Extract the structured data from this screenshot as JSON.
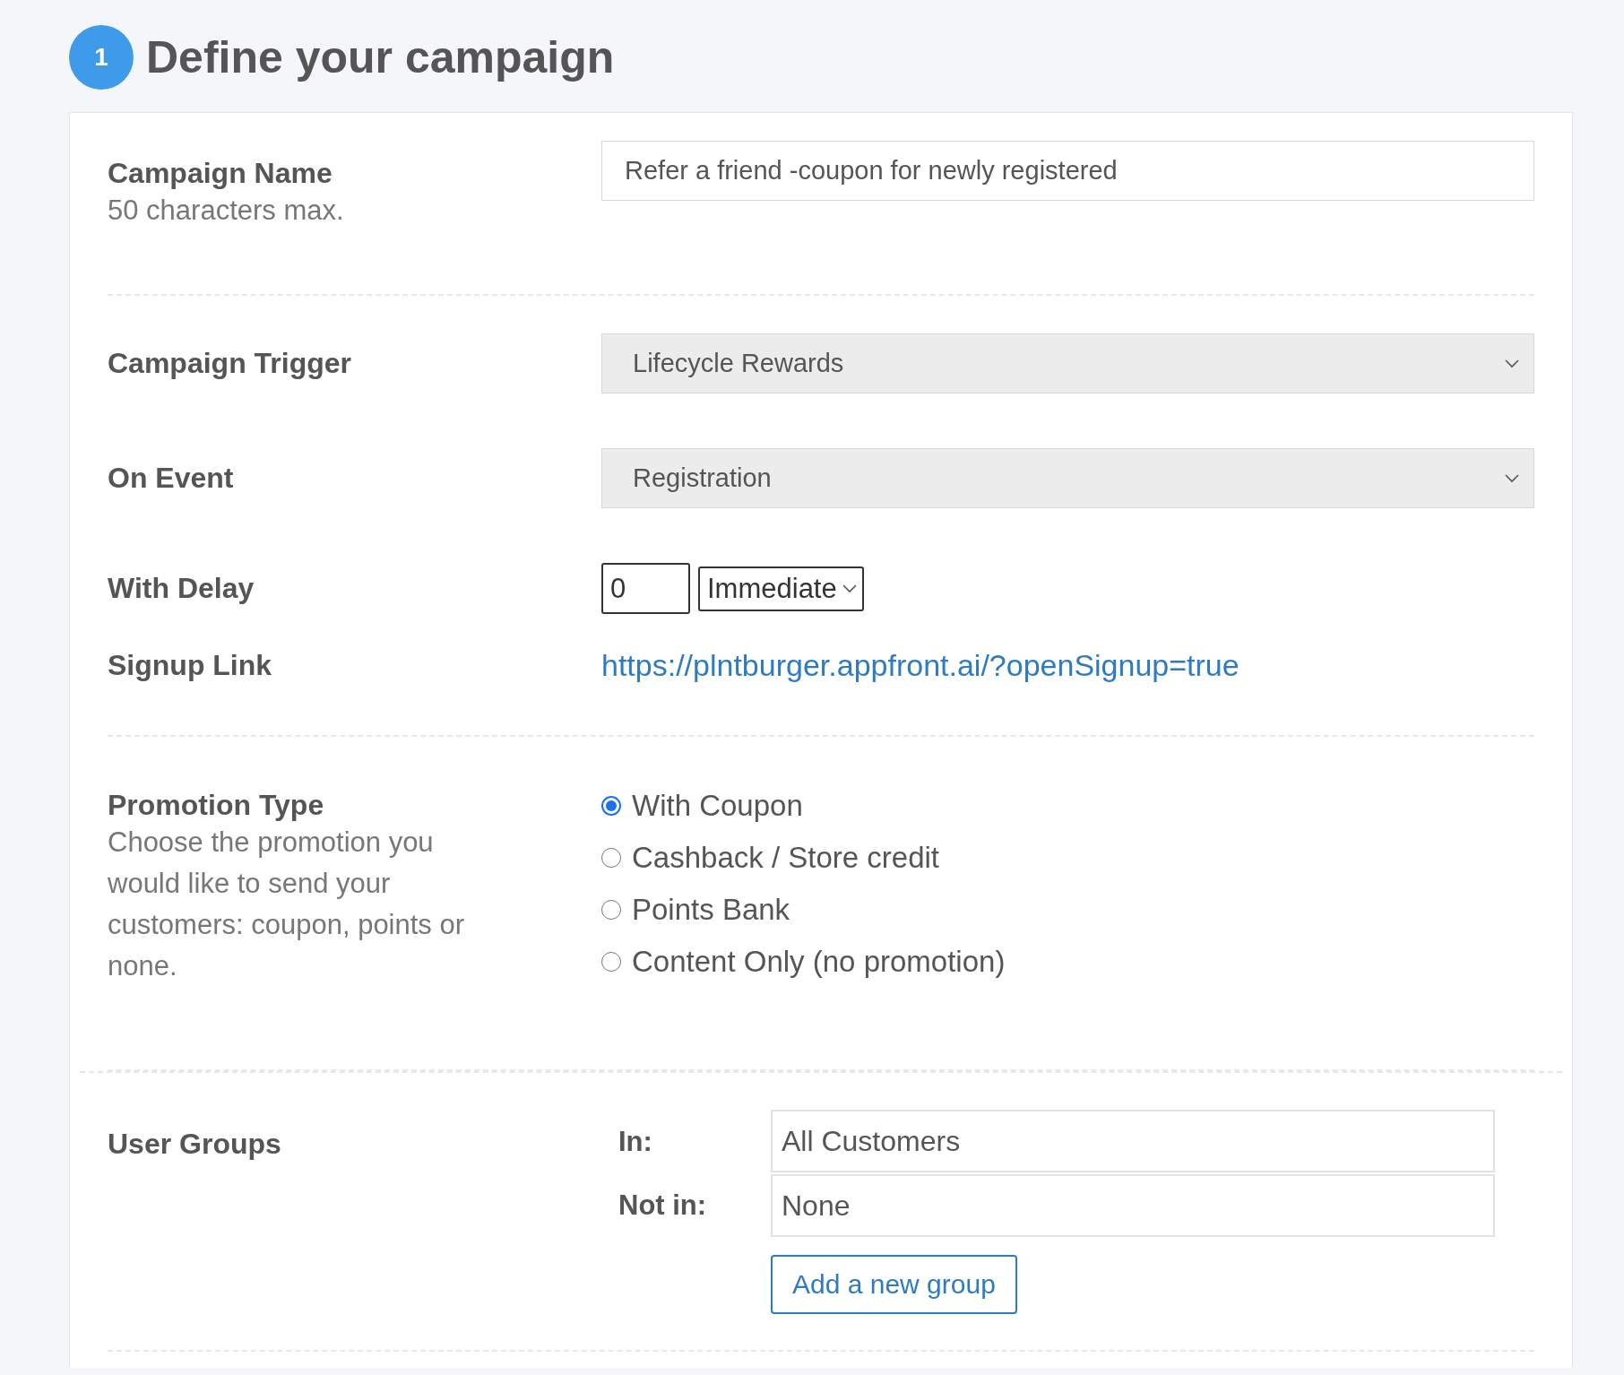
{
  "step": {
    "number": "1",
    "title": "Define your campaign"
  },
  "campaign_name": {
    "label": "Campaign Name",
    "hint": "50 characters max.",
    "value": "Refer a friend -coupon for newly registered"
  },
  "campaign_trigger": {
    "label": "Campaign Trigger",
    "value": "Lifecycle Rewards"
  },
  "on_event": {
    "label": "On Event",
    "value": "Registration"
  },
  "with_delay": {
    "label": "With Delay",
    "amount": "0",
    "unit": "Immediate"
  },
  "signup_link": {
    "label": "Signup Link",
    "url": "https://plntburger.appfront.ai/?openSignup=true"
  },
  "promotion_type": {
    "label": "Promotion Type",
    "hint": "Choose the promotion you would like to send your customers: coupon, points or none.",
    "options": [
      {
        "label": "With Coupon",
        "selected": true
      },
      {
        "label": "Cashback / Store credit",
        "selected": false
      },
      {
        "label": "Points Bank",
        "selected": false
      },
      {
        "label": "Content Only (no promotion)",
        "selected": false
      }
    ]
  },
  "user_groups": {
    "label": "User Groups",
    "in_label": "In:",
    "in_value": "All Customers",
    "not_in_label": "Not in:",
    "not_in_value": "None",
    "button": "Add a new group"
  }
}
